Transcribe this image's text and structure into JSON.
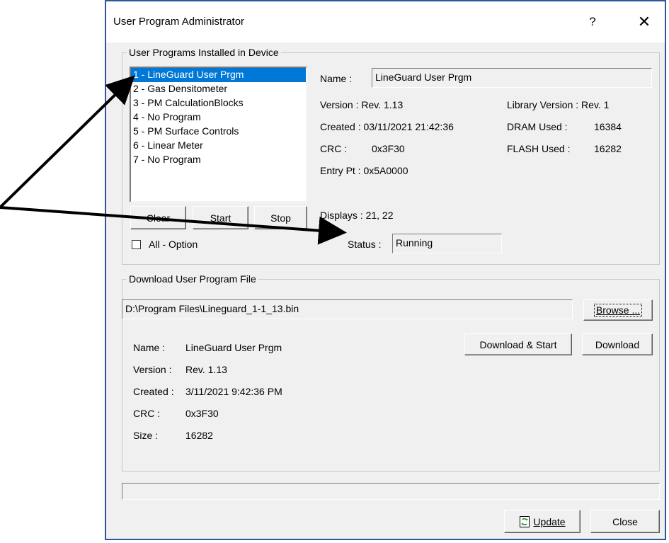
{
  "window": {
    "title": "User Program Administrator",
    "help_label": "?",
    "close_glyph": "✕",
    "border_color": "#2b579a"
  },
  "installed": {
    "group_label": "User Programs Installed in Device",
    "programs": [
      "1 - LineGuard User Prgm",
      "2 - Gas Densitometer",
      "3 - PM CalculationBlocks",
      "4 - No Program",
      "5 - PM Surface Controls",
      "6 - Linear Meter",
      "7 - No Program"
    ],
    "selected_index": 0,
    "clear_label": "Clear",
    "start_label": "Start",
    "stop_label": "Stop",
    "all_option_label": "All - Option",
    "name_label": "Name :",
    "name_value": "LineGuard User Prgm",
    "version_text": "Version : Rev. 1.13",
    "created_text": "Created : 03/11/2021 21:42:36",
    "crc_label": "CRC :",
    "crc_value": "0x3F30",
    "entry_text": "Entry Pt : 0x5A0000",
    "library_text": "Library Version : Rev. 1",
    "dram_label": "DRAM Used :",
    "dram_value": "16384",
    "flash_label": "FLASH Used :",
    "flash_value": "16282",
    "displays_text": "Displays : 21, 22",
    "status_label": "Status :",
    "status_value": "Running"
  },
  "download": {
    "group_label": "Download User Program File",
    "file_path": "D:\\Program Files\\Lineguard_1-1_13.bin",
    "browse_label": "Browse ...",
    "download_start_label": "Download & Start",
    "download_label": "Download",
    "name_label": "Name :",
    "name_value": "LineGuard User Prgm",
    "version_label": "Version :",
    "version_value": "Rev. 1.13",
    "created_label": "Created :",
    "created_value": "3/11/2021 9:42:36 PM",
    "crc_label": "CRC :",
    "crc_value": "0x3F30",
    "size_label": "Size :",
    "size_value": "16282"
  },
  "footer": {
    "update_label": "Update",
    "close_label": "Close",
    "update_icon": "refresh-document-icon",
    "update_icon_color": "#2e8b2e"
  },
  "progress": 0
}
